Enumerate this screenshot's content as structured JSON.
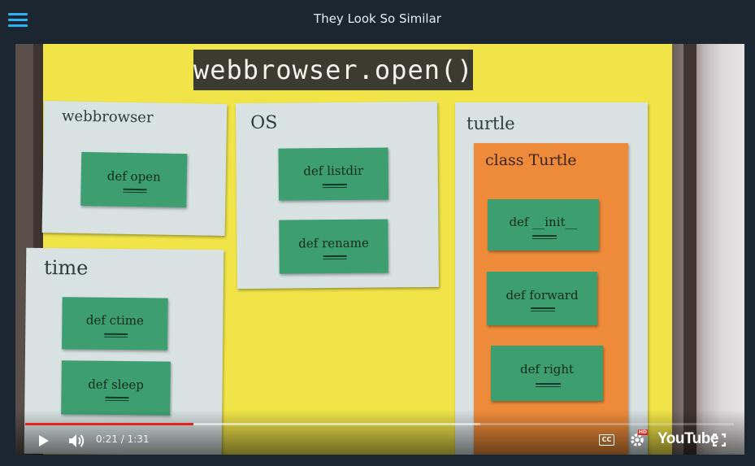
{
  "header": {
    "title": "They Look So Similar"
  },
  "video": {
    "caption": "webbrowser.open()",
    "cards": {
      "webbrowser": {
        "title": "webbrowser",
        "notes": [
          "def  open"
        ]
      },
      "os": {
        "title": "OS",
        "notes": [
          "def  listdir",
          "def  rename"
        ]
      },
      "time": {
        "title": "time",
        "notes": [
          "def  ctime",
          "def  sleep"
        ]
      },
      "turtle": {
        "title": "turtle",
        "class_title": "class Turtle",
        "notes": [
          "def  __init__",
          "def forward",
          "def  right"
        ]
      }
    }
  },
  "controls": {
    "current_time": "0:21",
    "separator": "/",
    "duration": "1:31",
    "progress_played": 0.237,
    "progress_loaded": 0.642,
    "logo": "YouTube",
    "hd_badge": "HD",
    "cc_label": "CC",
    "icons": [
      "menu-icon",
      "play-icon",
      "volume-icon",
      "captions-icon",
      "settings-icon",
      "fullscreen-icon"
    ]
  },
  "colors": {
    "accent": "#2bb2f3",
    "progress": "#e6221a",
    "board": "#f0e448",
    "note": "#3d9e70",
    "orange_card": "#ee8b3a"
  }
}
